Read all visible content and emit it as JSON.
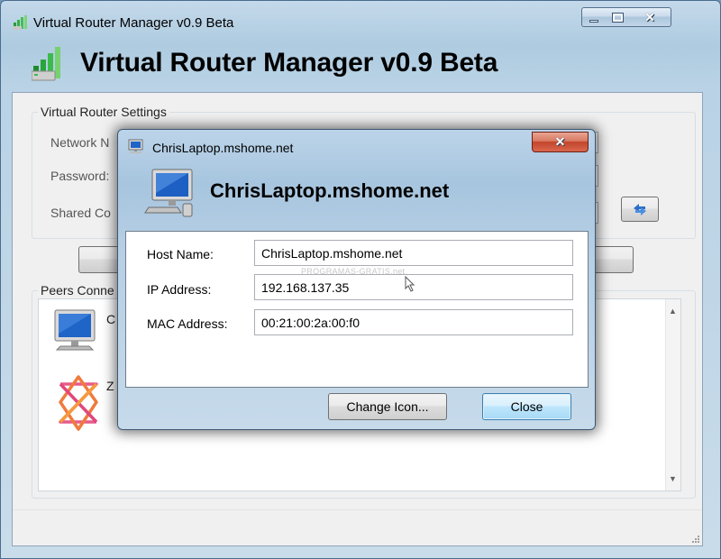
{
  "window": {
    "title": "Virtual Router Manager v0.9 Beta",
    "heading": "Virtual Router Manager v0.9 Beta",
    "accent_color": "#1f9e2f"
  },
  "settings": {
    "group_label": "Virtual Router Settings",
    "network_name_label": "Network N",
    "password_label": "Password:",
    "shared_connection_label": "Shared Co",
    "refresh_icon": "refresh-arrows-icon"
  },
  "peers": {
    "group_label": "Peers Conne",
    "items": [
      {
        "name": "C",
        "icon": "computer-monitor-icon"
      },
      {
        "name": "Z",
        "icon": "zune-logo-icon"
      }
    ],
    "scroll_up": "▲",
    "scroll_down": "▼"
  },
  "dialog": {
    "title": "ChrisLaptop.mshome.net",
    "heading": "ChrisLaptop.mshome.net",
    "close_glyph": "✕",
    "fields": {
      "host_label": "Host Name:",
      "host_value": "ChrisLaptop.mshome.net",
      "ip_label": "IP Address:",
      "ip_value": "192.168.137.35",
      "mac_label": "MAC Address:",
      "mac_value": "00:21:00:2a:00:f0"
    },
    "change_icon_label": "Change Icon...",
    "close_label": "Close"
  },
  "watermark": "PROGRAMAS-GRATIS.net",
  "caption_buttons": {
    "minimize": "minimize-icon",
    "maximize": "maximize-icon",
    "close": "✕"
  }
}
